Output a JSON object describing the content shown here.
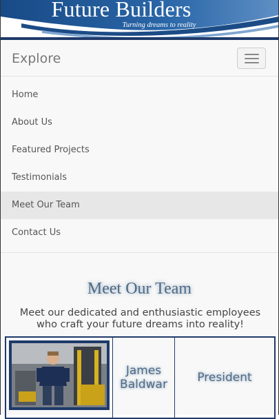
{
  "banner": {
    "title": "Future Builders",
    "tagline": "Turning dreams to reality",
    "colors": {
      "primary": "#1f4f8a",
      "dark": "#163a66",
      "accent": "#6f9fd0"
    }
  },
  "navbar": {
    "brand": "Explore",
    "toggle_icon": "hamburger-icon"
  },
  "menu": {
    "items": [
      {
        "label": "Home"
      },
      {
        "label": "About Us"
      },
      {
        "label": "Featured Projects"
      },
      {
        "label": "Testimonials"
      },
      {
        "label": "Meet Our Team",
        "active": true
      },
      {
        "label": "Contact Us"
      }
    ]
  },
  "content": {
    "title": "Meet Our Team",
    "intro": "Meet our dedicated and enthusiastic employees who craft your future dreams into reality!",
    "team": [
      {
        "photo": "employee-photo",
        "name": "James Baldwar",
        "role": "President"
      }
    ]
  }
}
